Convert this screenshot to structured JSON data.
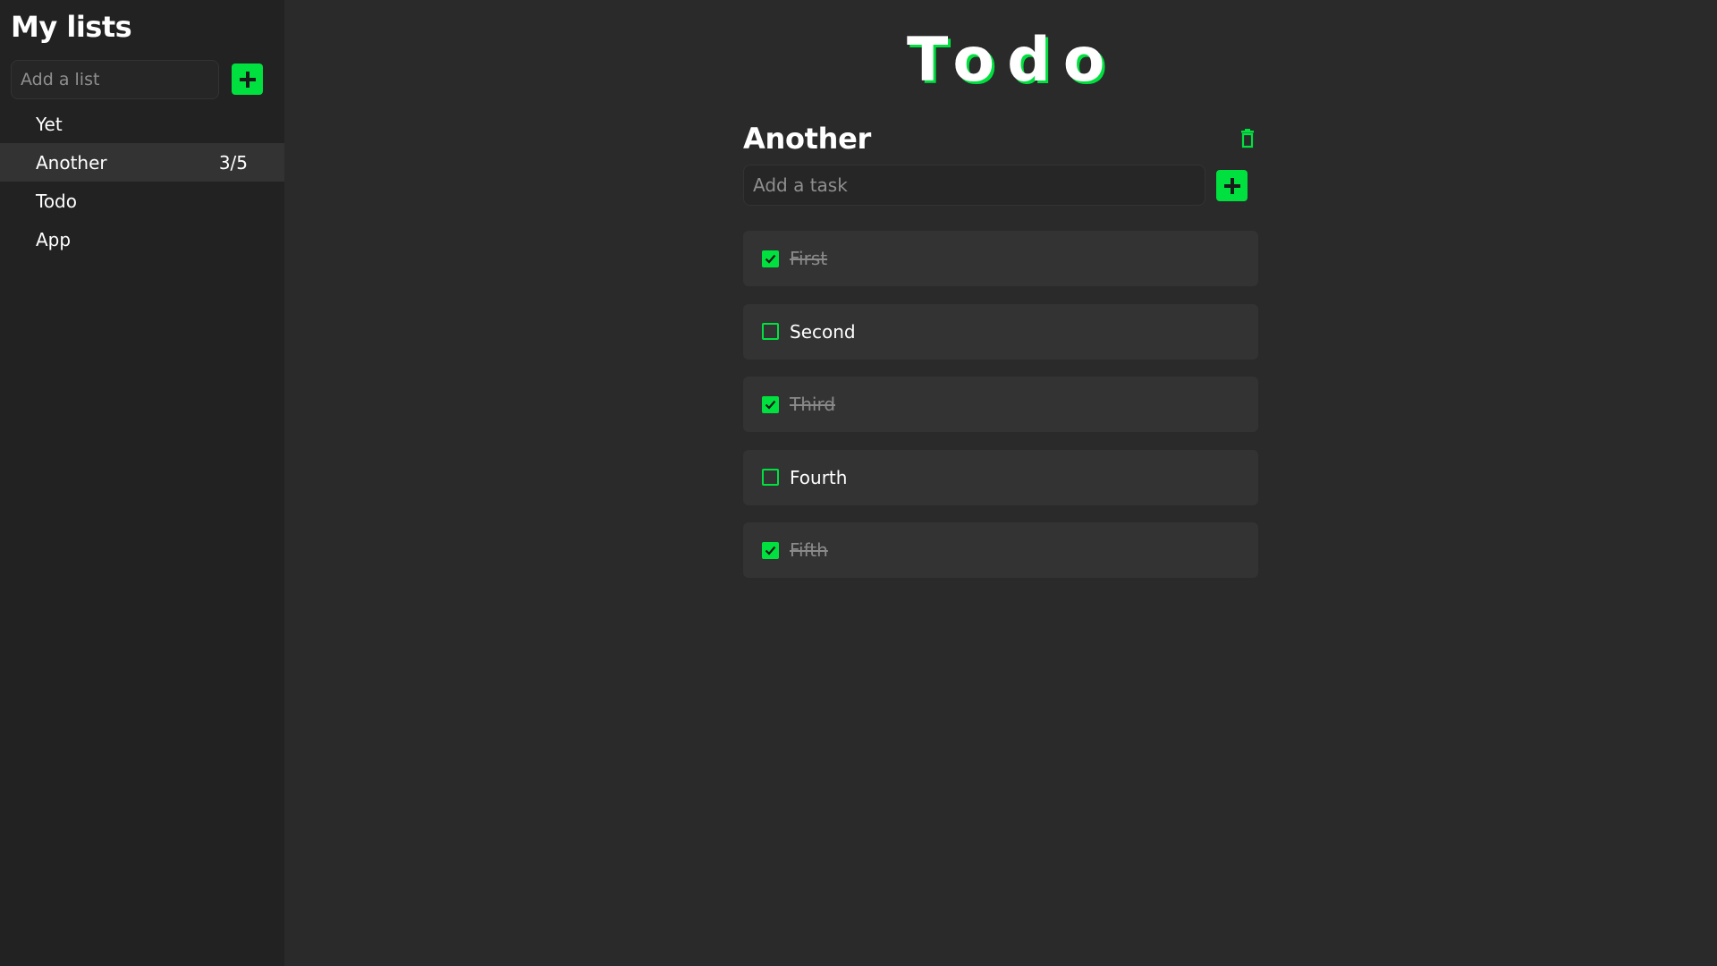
{
  "sidebar": {
    "title": "My lists",
    "input_placeholder": "Add a list",
    "add_icon": "plus-icon",
    "items": [
      {
        "label": "Yet",
        "count": "",
        "active": false
      },
      {
        "label": "Another",
        "count": "3/5",
        "active": true
      },
      {
        "label": "Todo",
        "count": "",
        "active": false
      },
      {
        "label": "App",
        "count": "",
        "active": false
      }
    ]
  },
  "main": {
    "app_title": "Todo",
    "list_title": "Another",
    "delete_icon": "trash-icon",
    "task_placeholder": "Add a task",
    "add_icon": "plus-icon",
    "tasks": [
      {
        "label": "First",
        "done": true
      },
      {
        "label": "Second",
        "done": false
      },
      {
        "label": "Third",
        "done": true
      },
      {
        "label": "Fourth",
        "done": false
      },
      {
        "label": "Fifth",
        "done": true
      }
    ]
  },
  "colors": {
    "accent": "#00e13f",
    "background": "#2a2a2a",
    "sidebar": "#222222",
    "card": "#333333"
  }
}
